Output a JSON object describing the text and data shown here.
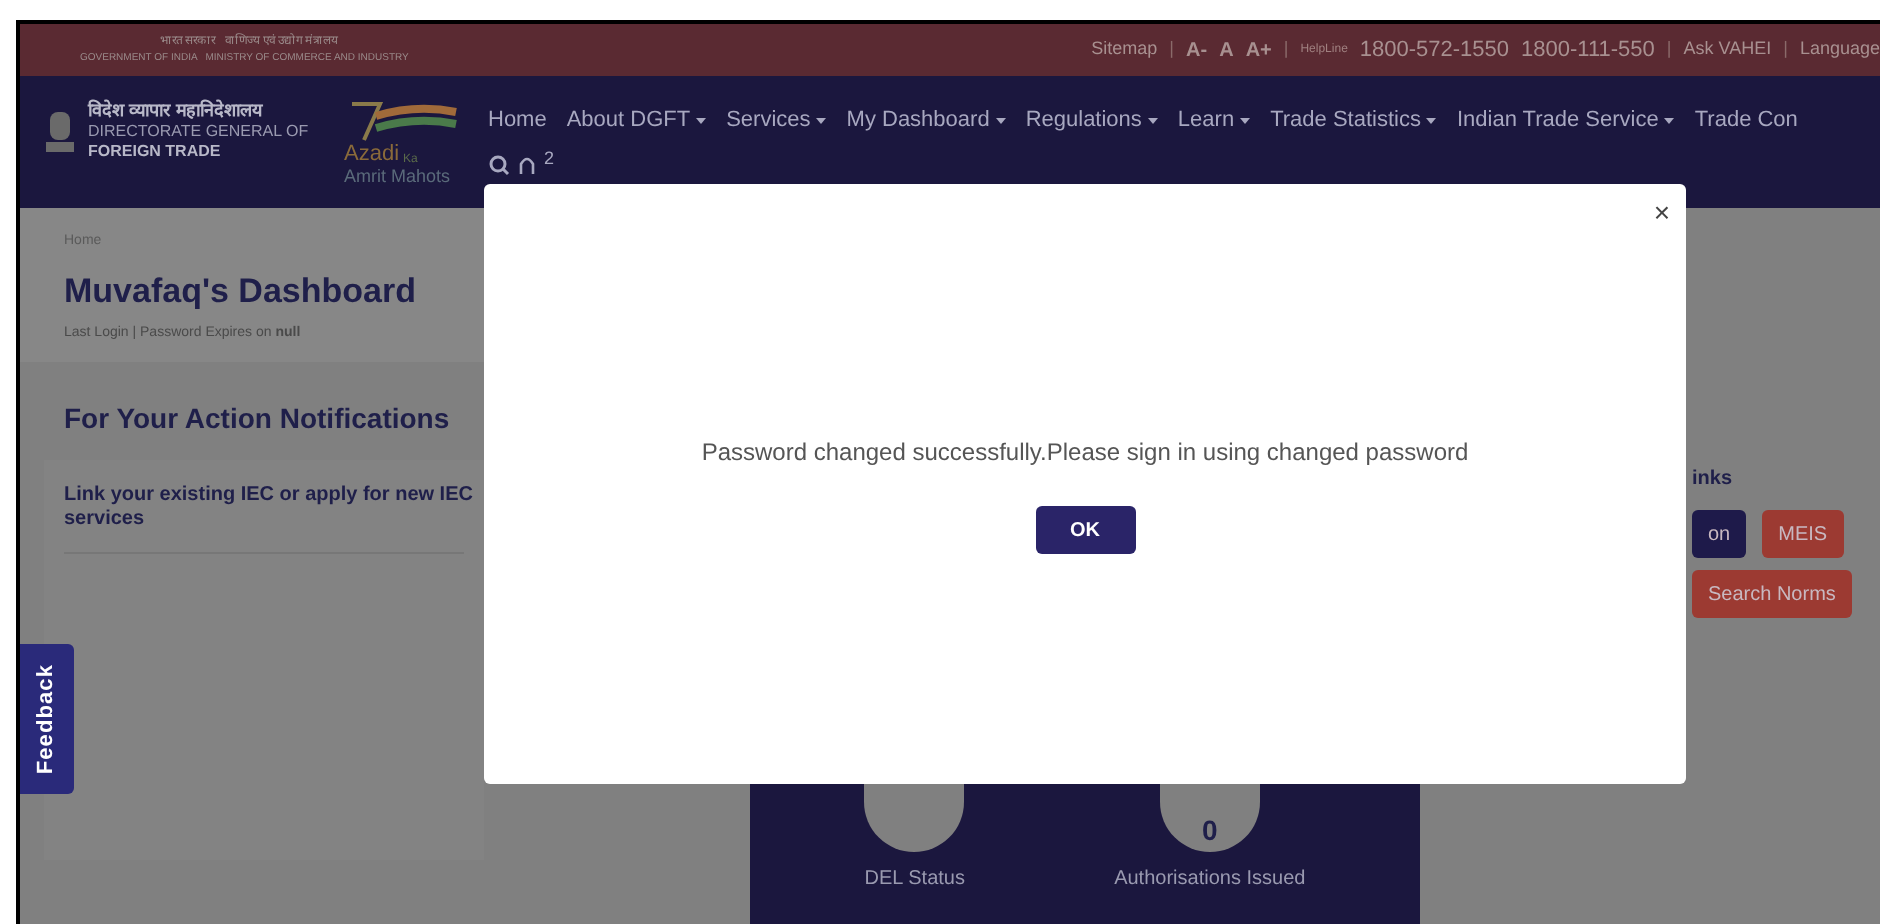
{
  "top_bar": {
    "ministry_hindi": "भारत सरकार   वाणिज्य एवं उद्योग मंत्रालय",
    "ministry_english": "GOVERNMENT OF INDIA   MINISTRY OF COMMERCE AND INDUSTRY",
    "links": [
      {
        "label": "Sitemap",
        "kind": "link"
      },
      {
        "label": "|",
        "kind": "sep"
      },
      {
        "label": "A-",
        "kind": "font"
      },
      {
        "label": "A",
        "kind": "font"
      },
      {
        "label": "A+",
        "kind": "font"
      },
      {
        "label": "|",
        "kind": "sep"
      },
      {
        "label": "HelpLine",
        "kind": "small"
      },
      {
        "label": "1800-572-1550",
        "kind": "phone"
      },
      {
        "label": "1800-111-550",
        "kind": "phone"
      },
      {
        "label": "|",
        "kind": "sep"
      },
      {
        "label": "Ask VAHEI",
        "kind": "link"
      },
      {
        "label": "|",
        "kind": "sep"
      },
      {
        "label": "Language",
        "kind": "link"
      }
    ]
  },
  "header": {
    "logo_hindi": "विदेश व्यापार महानिदेशालय",
    "logo_line1": "DIRECTORATE GENERAL OF",
    "logo_line2": "FOREIGN TRADE",
    "azadi": "Azadi",
    "ka": "Ka",
    "amrit": "Amrit Mahots",
    "nav": [
      {
        "label": "Home",
        "dropdown": false
      },
      {
        "label": "About DGFT",
        "dropdown": true
      },
      {
        "label": "Services",
        "dropdown": true
      },
      {
        "label": "My Dashboard",
        "dropdown": true
      },
      {
        "label": "Regulations",
        "dropdown": true
      },
      {
        "label": "Learn",
        "dropdown": true
      },
      {
        "label": "Trade Statistics",
        "dropdown": true
      },
      {
        "label": "Indian Trade Service",
        "dropdown": true
      },
      {
        "label": "Trade Con",
        "dropdown": false
      }
    ],
    "notification_count": "2"
  },
  "breadcrumb": "Home",
  "title": "Muvafaq's Dashboard",
  "last_login": "Last Login | Password Expires on **null**",
  "notifications": {
    "title": "For Your Action Notifications",
    "item": "Link your existing IEC or apply for new IEC",
    "item_line2": "services"
  },
  "quick_links": {
    "title": "inks",
    "buttons": [
      {
        "label": "on",
        "color": "#1e1a4a"
      },
      {
        "label": "MEIS",
        "color": "#9c3a32"
      },
      {
        "label": "Search Norms",
        "color": "#9c3a32"
      }
    ]
  },
  "stats": [
    {
      "label": "DEL Status"
    },
    {
      "label": "Authorisations Issued",
      "value": "0"
    }
  ],
  "feedback": "Feedback",
  "modal": {
    "message": "Password changed successfully.Please sign in using changed password",
    "ok": "OK",
    "close": "×"
  }
}
